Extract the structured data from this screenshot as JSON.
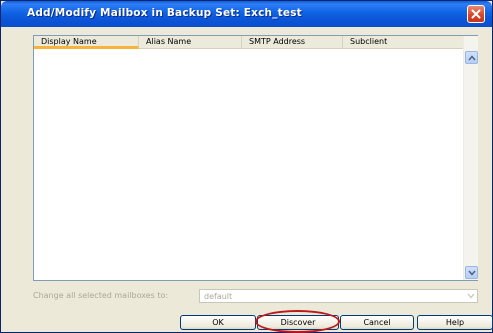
{
  "window": {
    "title": "Add/Modify Mailbox in Backup Set: Exch_test"
  },
  "table": {
    "columns": [
      "Display Name",
      "Alias Name",
      "SMTP Address",
      "Subclient"
    ],
    "rows": []
  },
  "change_all": {
    "label": "Change all selected mailboxes to:",
    "value": "default"
  },
  "buttons": {
    "ok": "OK",
    "discover": "Discover",
    "cancel": "Cancel",
    "help": "Help"
  },
  "icons": {
    "close": "close-icon",
    "column_menu": "double-chevron-down-icon",
    "scroll_up": "chevron-up-icon",
    "scroll_down": "chevron-down-icon",
    "combo_arrow": "chevron-down-icon"
  },
  "colors": {
    "title_bar": "#0b55d8",
    "close_button": "#d9482a",
    "sorted_column_underline": "#f8b33b",
    "highlight_annotation": "#c0171c"
  }
}
